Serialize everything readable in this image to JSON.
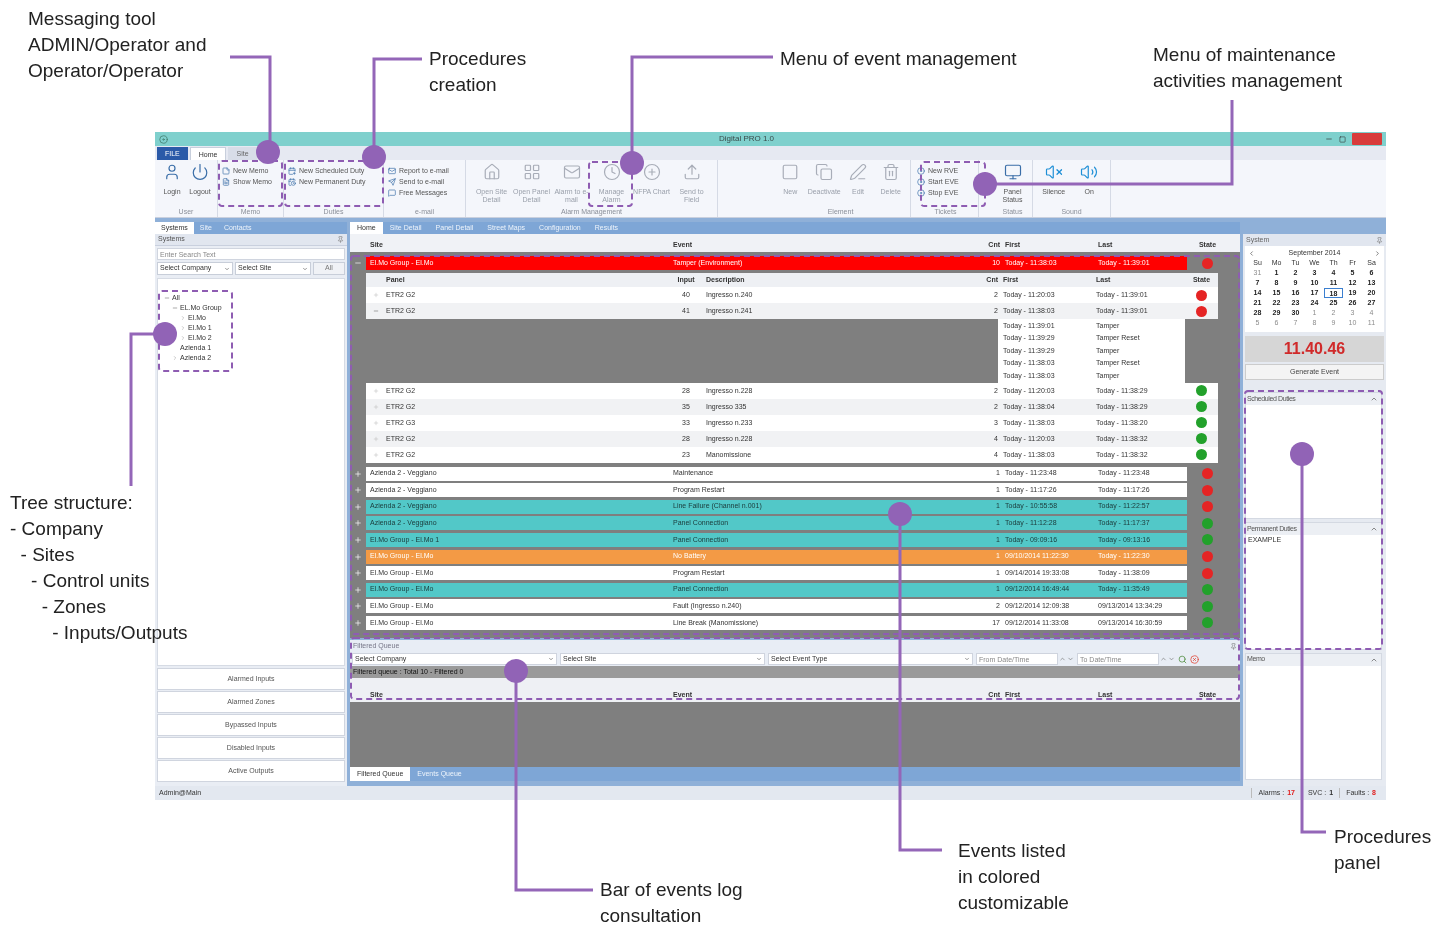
{
  "annotations": [
    {
      "text": "Messaging tool\nADMIN/Operator and\nOperator/Operator"
    },
    {
      "text": "Procedures\ncreation"
    },
    {
      "text": "Menu of event management"
    },
    {
      "text": "Menu of maintenance\nactivities management"
    },
    {
      "text": "Tree structure:\n- Company\n  - Sites\n    - Control units\n      - Zones\n        - Inputs/Outputs"
    },
    {
      "text": "Bar of events log\nconsultation"
    },
    {
      "text": "Events listed\nin colored\ncustomizable"
    },
    {
      "text": "Procedures\npanel"
    }
  ],
  "window": {
    "title": "Digital PRO 1.0"
  },
  "ribbon": {
    "file_menu": "FILE",
    "tabs": [
      {
        "label": "Home",
        "selected": true
      },
      {
        "label": "Site",
        "selected": false
      }
    ],
    "groups": [
      {
        "label": "User",
        "items": [
          {
            "label": "Login",
            "kind": "large",
            "disabled": false
          },
          {
            "label": "Logout",
            "kind": "large",
            "disabled": false
          }
        ]
      },
      {
        "label": "Memo",
        "items": [
          {
            "label": "New Memo",
            "kind": "small",
            "disabled": false
          },
          {
            "label": "Show Memo",
            "kind": "small",
            "disabled": false
          }
        ]
      },
      {
        "label": "Duties",
        "items": [
          {
            "label": "New Scheduled Duty",
            "kind": "small",
            "disabled": false
          },
          {
            "label": "New Permanent Duty",
            "kind": "small",
            "disabled": false
          }
        ]
      },
      {
        "label": "e-mail",
        "items": [
          {
            "label": "Report to e-mail",
            "kind": "small",
            "disabled": false
          },
          {
            "label": "Send to e-mail",
            "kind": "small",
            "disabled": false
          },
          {
            "label": "Free Messages",
            "kind": "small",
            "disabled": false
          }
        ]
      },
      {
        "label": "Alarm Management",
        "items": [
          {
            "label": "Open Site Detail",
            "kind": "large",
            "disabled": true
          },
          {
            "label": "Open Panel Detail",
            "kind": "large",
            "disabled": true
          },
          {
            "label": "Alarm to e-mail",
            "kind": "large",
            "disabled": true
          },
          {
            "label": "Manage Alarm",
            "kind": "large",
            "disabled": true
          },
          {
            "label": "NFPA Chart",
            "kind": "large",
            "disabled": true
          },
          {
            "label": "Send to Field",
            "kind": "large",
            "disabled": true
          }
        ]
      },
      {
        "label": "Element",
        "items": [
          {
            "label": "New",
            "kind": "large",
            "disabled": true
          },
          {
            "label": "Deactivate",
            "kind": "large",
            "disabled": true
          },
          {
            "label": "Edit",
            "kind": "large",
            "disabled": true
          },
          {
            "label": "Delete",
            "kind": "large",
            "disabled": true
          }
        ]
      },
      {
        "label": "Tickets",
        "items": [
          {
            "label": "New RVE",
            "kind": "small",
            "disabled": false
          },
          {
            "label": "Start EVE",
            "kind": "small",
            "disabled": false
          },
          {
            "label": "Stop EVE",
            "kind": "small",
            "disabled": false
          }
        ]
      },
      {
        "label": "Status",
        "items": [
          {
            "label": "Panel Status",
            "kind": "large",
            "disabled": false
          }
        ]
      },
      {
        "label": "Sound",
        "items": [
          {
            "label": "Silence",
            "kind": "large",
            "disabled": false
          },
          {
            "label": "On",
            "kind": "large",
            "disabled": false
          }
        ]
      }
    ]
  },
  "sidebar": {
    "tabs": [
      {
        "label": "Systems",
        "selected": true
      },
      {
        "label": "Site",
        "selected": false
      },
      {
        "label": "Contacts",
        "selected": false
      }
    ],
    "title": "Systems",
    "search": {
      "placeholder": "Enter Search Text"
    },
    "company_select": "Select Company",
    "site_select": "Select Site",
    "all_button": "All",
    "tree": [
      {
        "label": "All",
        "expanded": true,
        "children": [
          {
            "label": "EL.Mo Group",
            "expanded": true,
            "children": [
              {
                "label": "El.Mo",
                "expanded": false
              },
              {
                "label": "El.Mo 1",
                "expanded": false
              },
              {
                "label": "El.Mo 2",
                "expanded": false
              }
            ]
          },
          {
            "label": "Azienda 1"
          },
          {
            "label": "Azienda 2",
            "expanded": false
          }
        ]
      }
    ],
    "buttons": [
      "Alarmed Inputs",
      "Alarmed Zones",
      "Bypassed Inputs",
      "Disabled Inputs",
      "Active Outputs"
    ]
  },
  "main": {
    "tabs": [
      {
        "label": "Home",
        "selected": true
      },
      {
        "label": "Site Detail",
        "selected": false
      },
      {
        "label": "Panel Detail",
        "selected": false
      },
      {
        "label": "Street Maps",
        "selected": false
      },
      {
        "label": "Configuration",
        "selected": false
      },
      {
        "label": "Results",
        "selected": false
      }
    ],
    "columns": [
      "Site",
      "Event",
      "Cnt",
      "First",
      "Last",
      "State"
    ],
    "rows": [
      {
        "site": "El.Mo Group - El.Mo",
        "event": "Tamper (Environment)",
        "cnt": "10",
        "first": "Today - 11:38:03",
        "last": "Today - 11:39:01",
        "alarm": true,
        "kind": "alarm",
        "color": "#ff0000",
        "expanded": true,
        "details": {
          "columns": [
            "Panel",
            "Input",
            "Description",
            "Cnt",
            "First",
            "Last",
            "State"
          ],
          "rows": [
            {
              "panel": "ETR2 G2",
              "input": "40",
              "description": "Ingresso n.240",
              "cnt": "2",
              "first": "Today - 11:20:03",
              "last": "Today - 11:39:01",
              "alarm": true,
              "expanded": false
            },
            {
              "panel": "ETR2 G2",
              "input": "41",
              "description": "Ingresso n.241",
              "cnt": "2",
              "first": "Today - 11:38:03",
              "last": "Today - 11:39:01",
              "alarm": true,
              "expanded": true,
              "history": [
                {
                  "time": "Today - 11:39:01",
                  "event": "Tamper"
                },
                {
                  "time": "Today - 11:39:29",
                  "event": "Tamper Reset"
                },
                {
                  "time": "Today - 11:39:29",
                  "event": "Tamper"
                },
                {
                  "time": "Today - 11:38:03",
                  "event": "Tamper Reset"
                },
                {
                  "time": "Today - 11:38:03",
                  "event": "Tamper"
                }
              ]
            },
            {
              "panel": "ETR2 G2",
              "input": "28",
              "description": "Ingresso n.228",
              "cnt": "2",
              "first": "Today - 11:20:03",
              "last": "Today - 11:38:29",
              "alarm": false,
              "expanded": false
            },
            {
              "panel": "ETR2 G2",
              "input": "35",
              "description": "Ingresso 335",
              "cnt": "2",
              "first": "Today - 11:38:04",
              "last": "Today - 11:38:29",
              "alarm": false,
              "expanded": false
            },
            {
              "panel": "ETR2 G3",
              "input": "33",
              "description": "Ingresso n.233",
              "cnt": "3",
              "first": "Today - 11:38:03",
              "last": "Today - 11:38:20",
              "alarm": false,
              "expanded": false
            },
            {
              "panel": "ETR2 G2",
              "input": "28",
              "description": "Ingresso n.228",
              "cnt": "4",
              "first": "Today - 11:20:03",
              "last": "Today - 11:38:32",
              "alarm": false,
              "expanded": false
            },
            {
              "panel": "ETR2 G2",
              "input": "23",
              "description": "Manomissione",
              "cnt": "4",
              "first": "Today - 11:38:03",
              "last": "Today - 11:38:32",
              "alarm": false,
              "expanded": false
            }
          ]
        }
      },
      {
        "site": "Azienda 2 - Veggiano",
        "event": "Maintenance",
        "cnt": "1",
        "first": "Today - 11:23:48",
        "last": "Today - 11:23:48",
        "alarm": true,
        "kind": "event",
        "color": "#ffffff",
        "expanded": false
      },
      {
        "site": "Azienda 2 - Veggiano",
        "event": "Program Restart",
        "cnt": "1",
        "first": "Today - 11:17:26",
        "last": "Today - 11:17:26",
        "alarm": true,
        "kind": "event",
        "color": "#ffffff",
        "expanded": false
      },
      {
        "site": "Azienda 2 - Veggiano",
        "event": "Line Failure (Channel n.001)",
        "cnt": "1",
        "first": "Today - 10:55:58",
        "last": "Today - 11:22:57",
        "alarm": true,
        "kind": "connection",
        "color": "#52c8c8",
        "expanded": false
      },
      {
        "site": "Azienda 2 - Veggiano",
        "event": "Panel Connection",
        "cnt": "1",
        "first": "Today - 11:12:28",
        "last": "Today - 11:17:37",
        "alarm": false,
        "kind": "connection",
        "color": "#52c8c8",
        "expanded": false
      },
      {
        "site": "El.Mo Group - El.Mo 1",
        "event": "Panel Connection",
        "cnt": "1",
        "first": "Today - 09:09:16",
        "last": "Today - 09:13:16",
        "alarm": false,
        "kind": "connection",
        "color": "#52c8c8",
        "expanded": false
      },
      {
        "site": "El.Mo Group - El.Mo",
        "event": "No Battery",
        "cnt": "1",
        "first": "09/10/2014 11:22:30",
        "last": "Today - 11:22:30",
        "alarm": true,
        "kind": "warning",
        "color": "#f39a45",
        "expanded": false
      },
      {
        "site": "El.Mo Group - El.Mo",
        "event": "Program Restart",
        "cnt": "1",
        "first": "09/14/2014 19:33:08",
        "last": "Today - 11:38:09",
        "alarm": true,
        "kind": "event",
        "color": "#ffffff",
        "expanded": false
      },
      {
        "site": "El.Mo Group - El.Mo",
        "event": "Panel Connection",
        "cnt": "1",
        "first": "09/12/2014 16:49:44",
        "last": "Today - 11:35:49",
        "alarm": false,
        "kind": "connection",
        "color": "#52c8c8",
        "expanded": false
      },
      {
        "site": "El.Mo Group - El.Mo",
        "event": "Fault (Ingresso n.240)",
        "cnt": "2",
        "first": "09/12/2014 12:09:38",
        "last": "09/13/2014 13:34:29",
        "alarm": false,
        "kind": "event",
        "color": "#ffffff",
        "expanded": false
      },
      {
        "site": "El.Mo Group - El.Mo",
        "event": "Line Break (Manomissione)",
        "cnt": "17",
        "first": "09/12/2014 11:33:08",
        "last": "09/13/2014 16:30:59",
        "alarm": false,
        "kind": "event",
        "color": "#ffffff",
        "expanded": false
      }
    ],
    "queue": {
      "title": "Filtered Queue",
      "company": "Select Company",
      "site": "Select Site",
      "event_type": "Select Event Type",
      "from": {
        "placeholder": "From Date/Time"
      },
      "to": {
        "placeholder": "To Date/Time"
      },
      "summary": "Filtered queue : Total 10 - Filtered 0",
      "columns": [
        "Site",
        "Event",
        "Cnt",
        "First",
        "Last",
        "State"
      ]
    },
    "bottom_tabs": [
      {
        "label": "Filtered Queue",
        "selected": true
      },
      {
        "label": "Events Queue",
        "selected": false
      }
    ]
  },
  "right": {
    "title": "System",
    "calendar": {
      "month": "September 2014",
      "weekdays": [
        "Su",
        "Mo",
        "Tu",
        "We",
        "Th",
        "Fr",
        "Sa"
      ],
      "weeks": [
        [
          {
            "day": "31",
            "outside": true,
            "selected": false
          },
          {
            "day": "1",
            "outside": false,
            "selected": false
          },
          {
            "day": "2",
            "outside": false,
            "selected": false
          },
          {
            "day": "3",
            "outside": false,
            "selected": false
          },
          {
            "day": "4",
            "outside": false,
            "selected": false
          },
          {
            "day": "5",
            "outside": false,
            "selected": false
          },
          {
            "day": "6",
            "outside": false,
            "selected": false
          }
        ],
        [
          {
            "day": "7",
            "outside": false,
            "selected": false
          },
          {
            "day": "8",
            "outside": false,
            "selected": false
          },
          {
            "day": "9",
            "outside": false,
            "selected": false
          },
          {
            "day": "10",
            "outside": false,
            "selected": false
          },
          {
            "day": "11",
            "outside": false,
            "selected": false
          },
          {
            "day": "12",
            "outside": false,
            "selected": false
          },
          {
            "day": "13",
            "outside": false,
            "selected": false
          }
        ],
        [
          {
            "day": "14",
            "outside": false,
            "selected": false
          },
          {
            "day": "15",
            "outside": false,
            "selected": false
          },
          {
            "day": "16",
            "outside": false,
            "selected": false
          },
          {
            "day": "17",
            "outside": false,
            "selected": false
          },
          {
            "day": "18",
            "outside": false,
            "selected": true
          },
          {
            "day": "19",
            "outside": false,
            "selected": false
          },
          {
            "day": "20",
            "outside": false,
            "selected": false
          }
        ],
        [
          {
            "day": "21",
            "outside": false,
            "selected": false
          },
          {
            "day": "22",
            "outside": false,
            "selected": false
          },
          {
            "day": "23",
            "outside": false,
            "selected": false
          },
          {
            "day": "24",
            "outside": false,
            "selected": false
          },
          {
            "day": "25",
            "outside": false,
            "selected": false
          },
          {
            "day": "26",
            "outside": false,
            "selected": false
          },
          {
            "day": "27",
            "outside": false,
            "selected": false
          }
        ],
        [
          {
            "day": "28",
            "outside": false,
            "selected": false
          },
          {
            "day": "29",
            "outside": false,
            "selected": false
          },
          {
            "day": "30",
            "outside": false,
            "selected": false
          },
          {
            "day": "1",
            "outside": true,
            "selected": false
          },
          {
            "day": "2",
            "outside": true,
            "selected": false
          },
          {
            "day": "3",
            "outside": true,
            "selected": false
          },
          {
            "day": "4",
            "outside": true,
            "selected": false
          }
        ],
        [
          {
            "day": "5",
            "outside": true,
            "selected": false
          },
          {
            "day": "6",
            "outside": true,
            "selected": false
          },
          {
            "day": "7",
            "outside": true,
            "selected": false
          },
          {
            "day": "8",
            "outside": true,
            "selected": false
          },
          {
            "day": "9",
            "outside": true,
            "selected": false
          },
          {
            "day": "10",
            "outside": true,
            "selected": false
          },
          {
            "day": "11",
            "outside": true,
            "selected": false
          }
        ]
      ]
    },
    "clock": "11.40.46",
    "generate_button": "Generate Event",
    "panels": [
      {
        "title": "Scheduled Duties"
      },
      {
        "title": "Permanent Duties",
        "entries": [
          "EXAMPLE"
        ]
      },
      {
        "title": "Memo"
      }
    ]
  },
  "status_bar": {
    "user": "Admin@Main",
    "counters": [
      {
        "label": "Alarms :",
        "value": "17",
        "alert": true
      },
      {
        "label": "SVC :",
        "value": "1",
        "alert": false
      },
      {
        "label": "Faults :",
        "value": "8",
        "alert": true
      }
    ]
  }
}
